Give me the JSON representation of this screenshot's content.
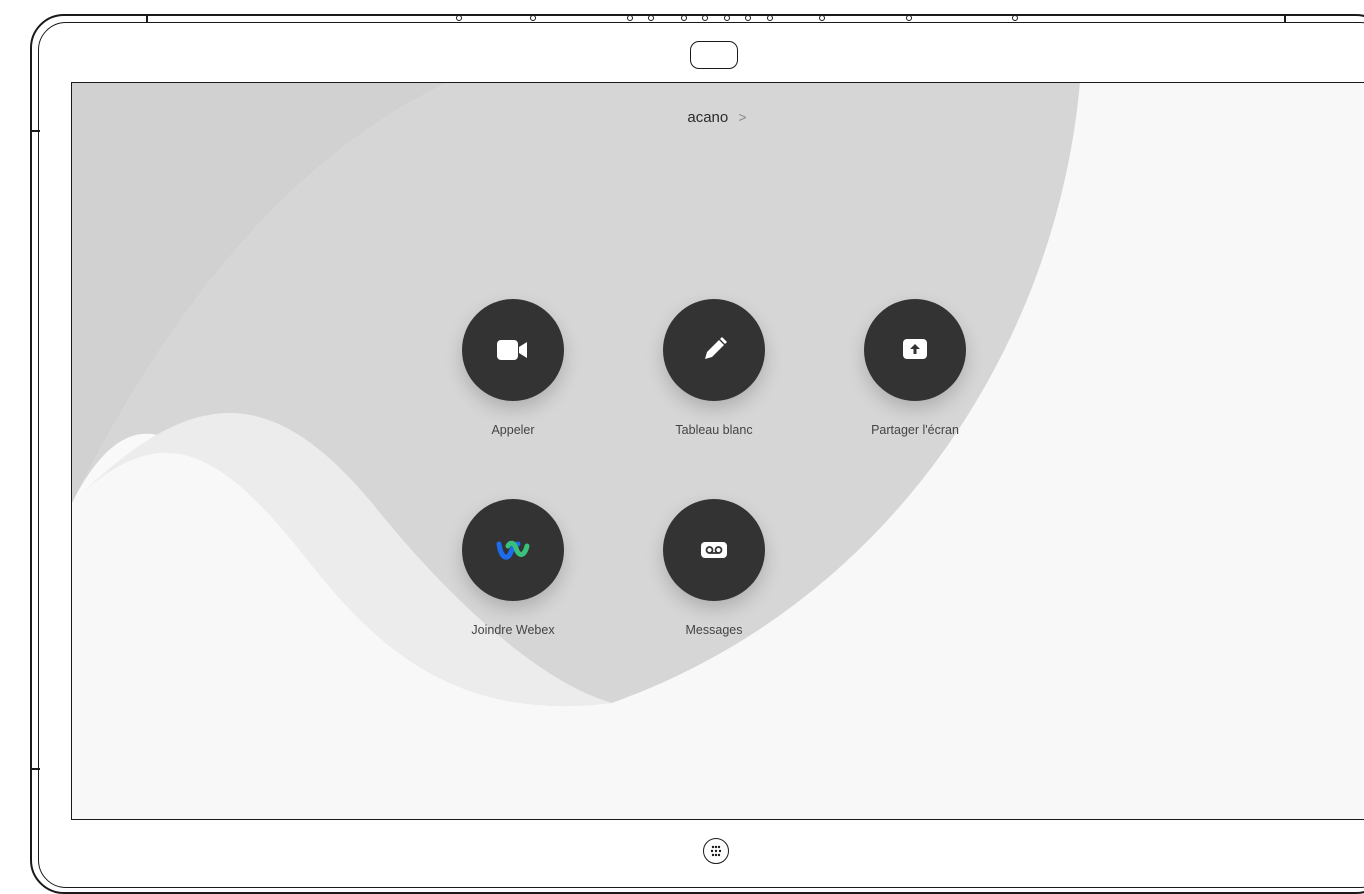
{
  "header": {
    "room_name": "acano",
    "room_chevron": ">"
  },
  "actions": [
    {
      "label": "Appeler",
      "icon": "video-camera-icon"
    },
    {
      "label": "Tableau blanc",
      "icon": "pencil-icon"
    },
    {
      "label": "Partager l'écran",
      "icon": "share-screen-icon"
    },
    {
      "label": "Joindre Webex",
      "icon": "webex-logo-icon"
    },
    {
      "label": "Messages",
      "icon": "voicemail-icon"
    }
  ],
  "colors": {
    "button_bg": "#333333",
    "label_text": "#444444",
    "webex_blue": "#1d6cf0",
    "webex_green": "#39c07a"
  }
}
